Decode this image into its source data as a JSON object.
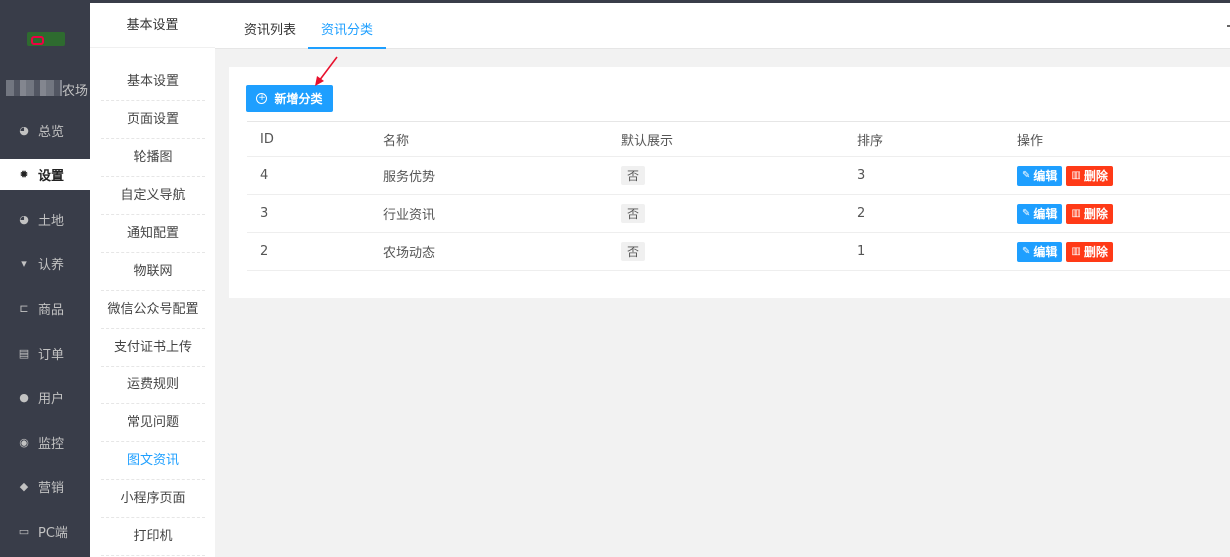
{
  "nav": {
    "farm_label": "农场",
    "items": [
      {
        "label": "总览",
        "icon": "dashboard-icon",
        "active": false
      },
      {
        "label": "设置",
        "icon": "gear-icon",
        "active": true
      },
      {
        "label": "土地",
        "icon": "globe-icon",
        "active": false
      },
      {
        "label": "认养",
        "icon": "bird-icon",
        "active": false
      },
      {
        "label": "商品",
        "icon": "cart-icon",
        "active": false
      },
      {
        "label": "订单",
        "icon": "list-icon",
        "active": false
      },
      {
        "label": "用户",
        "icon": "user-icon",
        "active": false
      },
      {
        "label": "监控",
        "icon": "monitor-dot-icon",
        "active": false
      },
      {
        "label": "营销",
        "icon": "tags-icon",
        "active": false
      },
      {
        "label": "PC端",
        "icon": "desktop-icon",
        "active": false
      }
    ]
  },
  "subnav": {
    "title": "基本设置",
    "items": [
      "基本设置",
      "页面设置",
      "轮播图",
      "自定义导航",
      "通知配置",
      "物联网",
      "微信公众号配置",
      "支付证书上传",
      "运费规则",
      "常见问题",
      "图文资讯",
      "小程序页面",
      "打印机"
    ],
    "active": "图文资讯"
  },
  "tabs": [
    {
      "label": "资讯列表",
      "active": false
    },
    {
      "label": "资讯分类",
      "active": true
    }
  ],
  "toolbar": {
    "add_label": "新增分类"
  },
  "table": {
    "headers": {
      "id": "ID",
      "name": "名称",
      "default": "默认展示",
      "sort": "排序",
      "op": "操作"
    },
    "edit_label": "编辑",
    "delete_label": "删除",
    "rows": [
      {
        "id": "4",
        "name": "服务优势",
        "default": "否",
        "sort": "3"
      },
      {
        "id": "3",
        "name": "行业资讯",
        "default": "否",
        "sort": "2"
      },
      {
        "id": "2",
        "name": "农场动态",
        "default": "否",
        "sort": "1"
      }
    ]
  },
  "colors": {
    "primary": "#1e9fff",
    "danger": "#ff3a17",
    "nav_bg": "#393d49"
  }
}
